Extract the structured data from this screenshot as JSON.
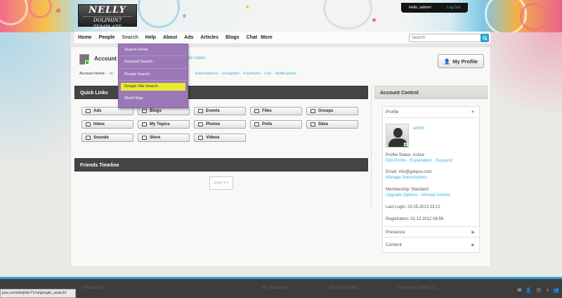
{
  "logo": {
    "name": "NELLY",
    "subtitle": "DOLPHIN7 TEMPLATE"
  },
  "userbar": {
    "greeting": "Hello, admin!",
    "logout": "Log Out"
  },
  "nav": {
    "items": [
      "Home",
      "People",
      "Search",
      "Help",
      "About",
      "Ads",
      "Articles",
      "Blogs",
      "Chat",
      "More"
    ],
    "active": "Search"
  },
  "search": {
    "value": "",
    "placeholder": "Search"
  },
  "dropdown": {
    "items": [
      "Search Home",
      "Keyword Search",
      "People Search",
      "Google Site Search",
      "World Map"
    ],
    "selected": "Google Site Search"
  },
  "account": {
    "title": "Account",
    "status_link": "date status",
    "my_profile": "My Profile",
    "crumbs_first": "Account Home",
    "crumbs_links": [
      "Subscriptions",
      "Unregister",
      "Payments",
      "Cart",
      "Notifications"
    ],
    "crumbs_prefix_link": "Av"
  },
  "quick_links": {
    "title": "Quick Links",
    "buttons": [
      {
        "label": "Ads",
        "icon": "camera-icon"
      },
      {
        "label": "Blogs",
        "icon": "book-icon"
      },
      {
        "label": "Events",
        "icon": "calendar-icon"
      },
      {
        "label": "Files",
        "icon": "folder-icon"
      },
      {
        "label": "Groups",
        "icon": "group-icon"
      },
      {
        "label": "Inbox",
        "icon": "envelope-icon"
      },
      {
        "label": "My Topics",
        "icon": "comments-icon"
      },
      {
        "label": "Photos",
        "icon": "picture-icon"
      },
      {
        "label": "Polls",
        "icon": "list-icon"
      },
      {
        "label": "Sites",
        "icon": "link-icon"
      },
      {
        "label": "Sounds",
        "icon": "music-icon"
      },
      {
        "label": "Store",
        "icon": "cart-icon"
      },
      {
        "label": "Videos",
        "icon": "film-icon"
      }
    ]
  },
  "friends_timeline": {
    "title": "Friends Timeline",
    "empty": "EMPTY"
  },
  "account_control": {
    "title": "Account Control",
    "profile_label": "Profile",
    "username": "admin",
    "profile_status_label": "Profile Status: Active",
    "profile_actions": [
      "Edit Profile",
      "Explanation",
      "Suspend"
    ],
    "email_label": "Email: info@gorpus.com",
    "email_action": "Manage Subscriptions",
    "membership_label": "Membership: Standard",
    "membership_actions": [
      "Upgrade Options",
      "Allowed Actions"
    ],
    "last_login": "Last Login: 23.05.2013 23:12",
    "registration": "Registration: 02.12.2012 08:56",
    "presence": "Presence",
    "content": "Content"
  },
  "footer": {
    "headings": [
      "About Us",
      "My Account",
      "Quick Links",
      "Connect With Us"
    ]
  },
  "status_url": "pus.com/dolphin71/m/google_search/",
  "colors": {
    "accent": "#27a3d3",
    "dropdown": "#9b79b8",
    "highlight": "#e9ea2a",
    "panel_dark": "#444444"
  }
}
